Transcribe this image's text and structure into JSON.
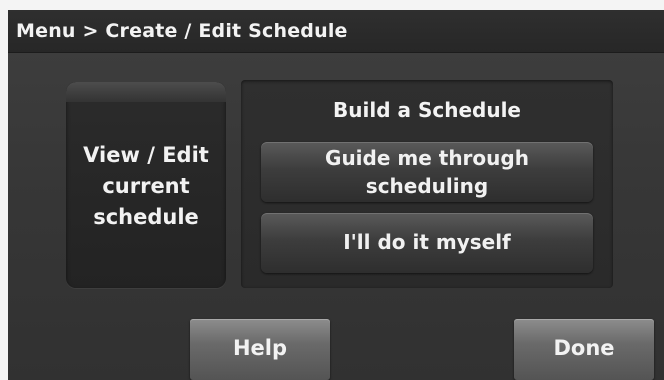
{
  "header": {
    "title": "Menu > Create / Edit Schedule"
  },
  "left_panel": {
    "label": "View / Edit\ncurrent\nschedule"
  },
  "build_section": {
    "heading": "Build a Schedule",
    "options": [
      {
        "label": "Guide me through\nscheduling"
      },
      {
        "label": "I'll do it myself"
      }
    ]
  },
  "footer": {
    "help_label": "Help",
    "done_label": "Done"
  }
}
